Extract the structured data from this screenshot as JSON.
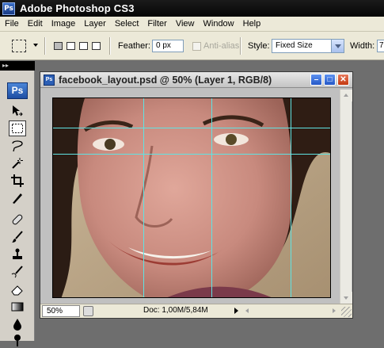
{
  "app": {
    "title": "Adobe Photoshop CS3",
    "logo_text": "Ps"
  },
  "menu": [
    "File",
    "Edit",
    "Image",
    "Layer",
    "Select",
    "Filter",
    "View",
    "Window",
    "Help"
  ],
  "options": {
    "feather_label": "Feather:",
    "feather_value": "0 px",
    "anti_alias_label": "Anti-alias",
    "style_label": "Style:",
    "style_value": "Fixed Size",
    "width_label": "Width:",
    "width_value": "7"
  },
  "toolbox": {
    "badge": "Ps",
    "tools": [
      "move-tool",
      "rectangular-marquee-tool",
      "lasso-tool",
      "magic-wand-tool",
      "crop-tool",
      "slice-tool",
      "healing-brush-tool",
      "brush-tool",
      "clone-stamp-tool",
      "history-brush-tool",
      "eraser-tool",
      "gradient-tool",
      "blur-tool",
      "dodge-tool"
    ]
  },
  "document": {
    "title": "facebook_layout.psd @ 50% (Layer 1, RGB/8)",
    "icon_text": "Ps",
    "zoom": "50%",
    "doc_size": "Doc: 1,00M/5,84M",
    "guide_color": "#5fe3e3"
  }
}
